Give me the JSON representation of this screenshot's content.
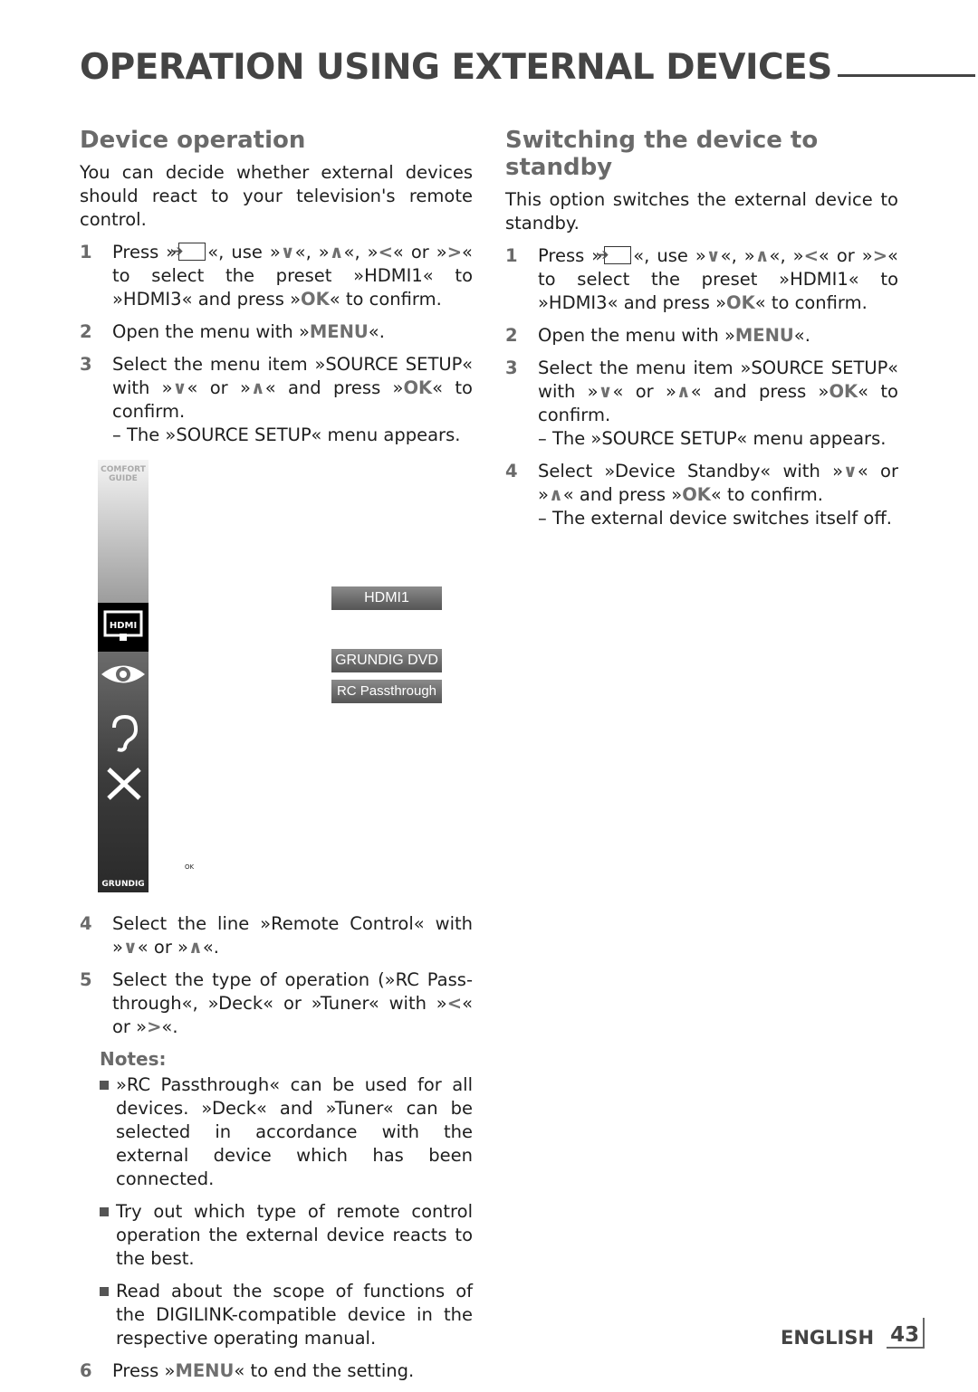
{
  "title": "OPERATION USING EXTERNAL DEVICES",
  "left": {
    "heading": "Device operation",
    "intro": "You can decide whether external devices should react to your television's remote control.",
    "steps": [
      {
        "num": "1",
        "segs": [
          {
            "t": "Press »"
          },
          {
            "i": "source"
          },
          {
            "t": "«, use »"
          },
          {
            "k": "∨"
          },
          {
            "t": "«, »"
          },
          {
            "k": "∧"
          },
          {
            "t": "«, »"
          },
          {
            "k": "<"
          },
          {
            "t": "« or »"
          },
          {
            "k": ">"
          },
          {
            "t": "« to select the preset »HDMI1« to »HDMI3« and press »"
          },
          {
            "k": "OK"
          },
          {
            "t": "« to confirm."
          }
        ]
      },
      {
        "num": "2",
        "segs": [
          {
            "t": "Open the menu with »"
          },
          {
            "k": "MENU"
          },
          {
            "t": "«."
          }
        ]
      },
      {
        "num": "3",
        "segs": [
          {
            "t": "Select the menu item »SOURCE SETUP« with »"
          },
          {
            "k": "∨"
          },
          {
            "t": "« or »"
          },
          {
            "k": "∧"
          },
          {
            "t": "« and press »"
          },
          {
            "k": "OK"
          },
          {
            "t": "« to confirm."
          },
          {
            "s": "– The »SOURCE SETUP« menu appears."
          }
        ]
      }
    ],
    "steps_after": [
      {
        "num": "4",
        "segs": [
          {
            "t": "Select the line »Remote Control« with »"
          },
          {
            "k": "∨"
          },
          {
            "t": "« or »"
          },
          {
            "k": "∧"
          },
          {
            "t": "«."
          }
        ]
      },
      {
        "num": "5",
        "segs": [
          {
            "t": "Select the type of operation (»RC Pass­through«, »Deck« or »Tuner« with »"
          },
          {
            "k": "<"
          },
          {
            "t": "« or »"
          },
          {
            "k": ">"
          },
          {
            "t": "«."
          }
        ]
      }
    ],
    "notes_heading": "Notes:",
    "notes": [
      "»RC Passthrough« can be used for all devices. »Deck« and »Tuner« can be selected in accordance with the external device which has been connected.",
      "Try out which type of remote control operation the external device reacts to the best.",
      "Read about the scope of functions of the DIGILINK-compatible device in the respective operating manual."
    ],
    "steps_final": [
      {
        "num": "6",
        "segs": [
          {
            "t": "Press »"
          },
          {
            "k": "MENU"
          },
          {
            "t": "« to end the setting."
          }
        ]
      }
    ]
  },
  "menu": {
    "comfort_guide": "COMFORT GUIDE",
    "brand": "GRUNDIG",
    "hdmi_icon_label": "HDMI",
    "source": "HDMI1",
    "device": "GRUNDIG DVD",
    "remote_mode": "RC Passthrough",
    "ok_label": "OK",
    "icons": [
      "hdmi-icon",
      "eye-icon",
      "ear-icon",
      "tools-icon"
    ]
  },
  "right": {
    "heading": "Switching the device to standby",
    "intro": "This option switches the external device to standby.",
    "steps": [
      {
        "num": "1",
        "segs": [
          {
            "t": "Press »"
          },
          {
            "i": "source"
          },
          {
            "t": "«, use »"
          },
          {
            "k": "∨"
          },
          {
            "t": "«, »"
          },
          {
            "k": "∧"
          },
          {
            "t": "«, »"
          },
          {
            "k": "<"
          },
          {
            "t": "« or »"
          },
          {
            "k": ">"
          },
          {
            "t": "« to select the preset »HDMI1« to »HDMI3« and press »"
          },
          {
            "k": "OK"
          },
          {
            "t": "« to confirm."
          }
        ]
      },
      {
        "num": "2",
        "segs": [
          {
            "t": "Open the menu with »"
          },
          {
            "k": "MENU"
          },
          {
            "t": "«."
          }
        ]
      },
      {
        "num": "3",
        "segs": [
          {
            "t": "Select the menu item »SOURCE SETUP« with »"
          },
          {
            "k": "∨"
          },
          {
            "t": "« or »"
          },
          {
            "k": "∧"
          },
          {
            "t": "« and press »"
          },
          {
            "k": "OK"
          },
          {
            "t": "« to confirm."
          },
          {
            "s": "– The »SOURCE SETUP« menu appears."
          }
        ]
      },
      {
        "num": "4",
        "segs": [
          {
            "t": "Select »Device Standby« with »"
          },
          {
            "k": "∨"
          },
          {
            "t": "« or »"
          },
          {
            "k": "∧"
          },
          {
            "t": "« and press »"
          },
          {
            "k": "OK"
          },
          {
            "t": "« to confirm."
          },
          {
            "s": "– The external device switches itself off."
          }
        ]
      }
    ]
  },
  "footer": {
    "language": "ENGLISH",
    "page": "43"
  }
}
